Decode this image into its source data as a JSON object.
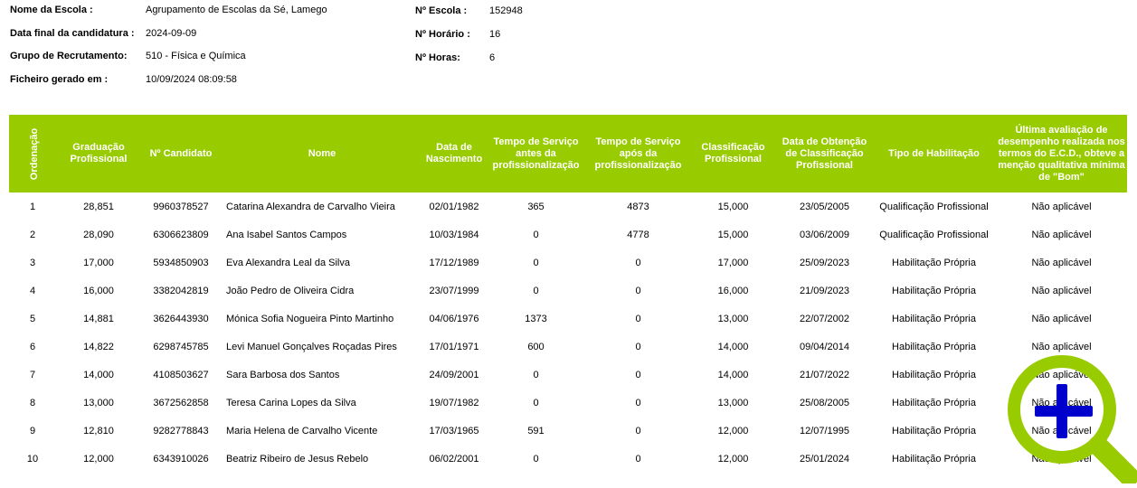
{
  "header": {
    "school_label": "Nome da Escola :",
    "school_value": "Agrupamento de Escolas da Sé, Lamego",
    "deadline_label": "Data final da candidatura :",
    "deadline_value": "2024-09-09",
    "group_label": "Grupo de Recrutamento:",
    "group_value": "510 - Física e Química",
    "generated_label": "Ficheiro gerado em :",
    "generated_value": "10/09/2024 08:09:58",
    "school_no_label": "Nº Escola :",
    "school_no_value": "152948",
    "schedule_label": "Nº Horário :",
    "schedule_value": "16",
    "hours_label": "Nº Horas:",
    "hours_value": "6"
  },
  "table": {
    "columns": [
      "Ordenação",
      "Graduação Profissional",
      "Nº Candidato",
      "Nome",
      "Data de Nascimento",
      "Tempo de Serviço antes da profissionalização",
      "Tempo de Serviço após da profissionalização",
      "Classificação Profissional",
      "Data de Obtenção de Classificação Profissional",
      "Tipo de Habilitação",
      "Última avaliação de desempenho realizada nos termos do E.C.D., obteve a menção qualitativa mínima de \"Bom\""
    ],
    "rows": [
      [
        "1",
        "28,851",
        "9960378527",
        "Catarina Alexandra de Carvalho Vieira",
        "02/01/1982",
        "365",
        "4873",
        "15,000",
        "23/05/2005",
        "Qualificação Profissional",
        "Não aplicável"
      ],
      [
        "2",
        "28,090",
        "6306623809",
        "Ana Isabel Santos Campos",
        "10/03/1984",
        "0",
        "4778",
        "15,000",
        "03/06/2009",
        "Qualificação Profissional",
        "Não aplicável"
      ],
      [
        "3",
        "17,000",
        "5934850903",
        "Eva Alexandra Leal da Silva",
        "17/12/1989",
        "0",
        "0",
        "17,000",
        "25/09/2023",
        "Habilitação Própria",
        "Não aplicável"
      ],
      [
        "4",
        "16,000",
        "3382042819",
        "João Pedro de Oliveira Cidra",
        "23/07/1999",
        "0",
        "0",
        "16,000",
        "21/09/2023",
        "Habilitação Própria",
        "Não aplicável"
      ],
      [
        "5",
        "14,881",
        "3626443930",
        "Mónica Sofia Nogueira Pinto Martinho",
        "04/06/1976",
        "1373",
        "0",
        "13,000",
        "22/07/2002",
        "Habilitação Própria",
        "Não aplicável"
      ],
      [
        "6",
        "14,822",
        "6298745785",
        "Levi Manuel Gonçalves Roçadas Pires",
        "17/01/1971",
        "600",
        "0",
        "14,000",
        "09/04/2014",
        "Habilitação Própria",
        "Não aplicável"
      ],
      [
        "7",
        "14,000",
        "4108503627",
        "Sara Barbosa dos Santos",
        "24/09/2001",
        "0",
        "0",
        "14,000",
        "21/07/2022",
        "Habilitação Própria",
        "Não aplicável"
      ],
      [
        "8",
        "13,000",
        "3672562858",
        "Teresa Carina Lopes da Silva",
        "19/07/1982",
        "0",
        "0",
        "13,000",
        "25/08/2005",
        "Habilitação Própria",
        "Não aplicável"
      ],
      [
        "9",
        "12,810",
        "9282778843",
        "Maria Helena de Carvalho Vicente",
        "17/03/1965",
        "591",
        "0",
        "12,000",
        "12/07/1995",
        "Habilitação Própria",
        "Não aplicável"
      ],
      [
        "10",
        "12,000",
        "6343910026",
        "Beatriz Ribeiro de Jesus Rebelo",
        "06/02/2001",
        "0",
        "0",
        "12,000",
        "25/01/2024",
        "Habilitação Própria",
        "Não aplicável"
      ]
    ]
  },
  "zoom_button": {
    "icon": "zoom-in-magnifier-icon",
    "ring_color": "#99cc00",
    "plus_color": "#0000cc"
  },
  "colors": {
    "header_bg": "#99cc00",
    "header_text": "#ffffff"
  }
}
